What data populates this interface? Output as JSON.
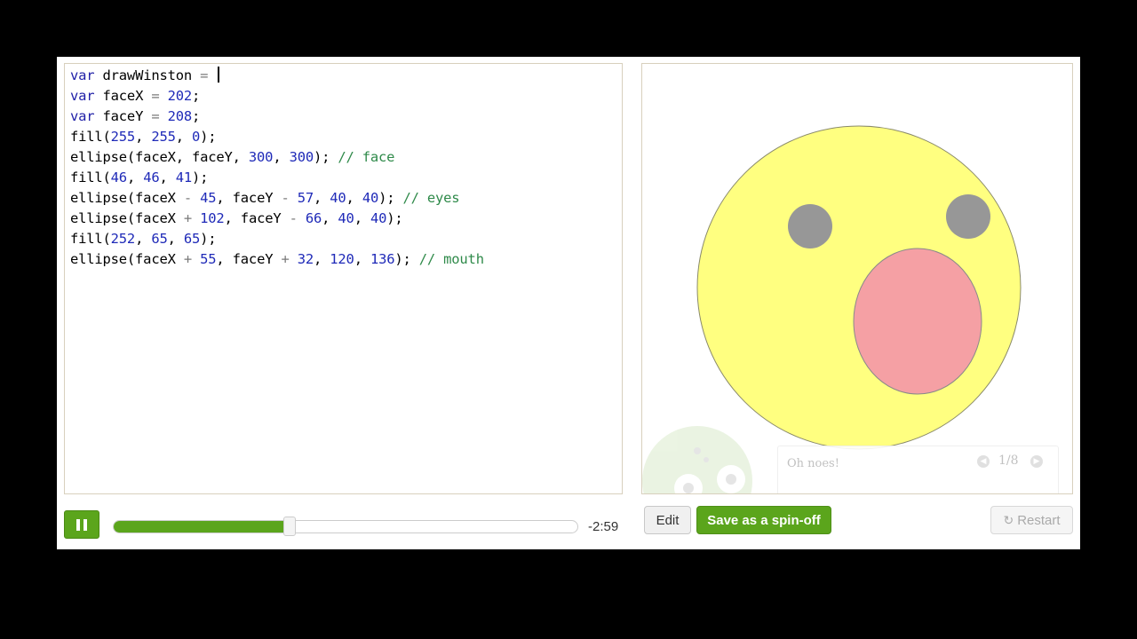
{
  "editor": {
    "lines": [
      [
        {
          "t": "var",
          "c": "kw"
        },
        {
          "t": " drawWinston "
        },
        {
          "t": "=",
          "c": "op"
        },
        {
          "t": " "
        }
      ],
      [
        {
          "t": "var",
          "c": "kw"
        },
        {
          "t": " faceX "
        },
        {
          "t": "=",
          "c": "op"
        },
        {
          "t": " "
        },
        {
          "t": "202",
          "c": "num"
        },
        {
          "t": ";"
        }
      ],
      [
        {
          "t": "var",
          "c": "kw"
        },
        {
          "t": " faceY "
        },
        {
          "t": "=",
          "c": "op"
        },
        {
          "t": " "
        },
        {
          "t": "208",
          "c": "num"
        },
        {
          "t": ";"
        }
      ],
      [
        {
          "t": "fill("
        },
        {
          "t": "255",
          "c": "num"
        },
        {
          "t": ", "
        },
        {
          "t": "255",
          "c": "num"
        },
        {
          "t": ", "
        },
        {
          "t": "0",
          "c": "num"
        },
        {
          "t": ");"
        }
      ],
      [
        {
          "t": "ellipse(faceX, faceY, "
        },
        {
          "t": "300",
          "c": "num"
        },
        {
          "t": ", "
        },
        {
          "t": "300",
          "c": "num"
        },
        {
          "t": "); "
        },
        {
          "t": "// face",
          "c": "cmt"
        }
      ],
      [
        {
          "t": "fill("
        },
        {
          "t": "46",
          "c": "num"
        },
        {
          "t": ", "
        },
        {
          "t": "46",
          "c": "num"
        },
        {
          "t": ", "
        },
        {
          "t": "41",
          "c": "num"
        },
        {
          "t": ");"
        }
      ],
      [
        {
          "t": "ellipse(faceX "
        },
        {
          "t": "-",
          "c": "op"
        },
        {
          "t": " "
        },
        {
          "t": "45",
          "c": "num"
        },
        {
          "t": ", faceY "
        },
        {
          "t": "-",
          "c": "op"
        },
        {
          "t": " "
        },
        {
          "t": "57",
          "c": "num"
        },
        {
          "t": ", "
        },
        {
          "t": "40",
          "c": "num"
        },
        {
          "t": ", "
        },
        {
          "t": "40",
          "c": "num"
        },
        {
          "t": "); "
        },
        {
          "t": "// eyes",
          "c": "cmt"
        }
      ],
      [
        {
          "t": "ellipse(faceX "
        },
        {
          "t": "+",
          "c": "op"
        },
        {
          "t": " "
        },
        {
          "t": "102",
          "c": "num"
        },
        {
          "t": ", faceY "
        },
        {
          "t": "-",
          "c": "op"
        },
        {
          "t": " "
        },
        {
          "t": "66",
          "c": "num"
        },
        {
          "t": ", "
        },
        {
          "t": "40",
          "c": "num"
        },
        {
          "t": ", "
        },
        {
          "t": "40",
          "c": "num"
        },
        {
          "t": ");"
        }
      ],
      [
        {
          "t": "fill("
        },
        {
          "t": "252",
          "c": "num"
        },
        {
          "t": ", "
        },
        {
          "t": "65",
          "c": "num"
        },
        {
          "t": ", "
        },
        {
          "t": "65",
          "c": "num"
        },
        {
          "t": ");"
        }
      ],
      [
        {
          "t": "ellipse(faceX "
        },
        {
          "t": "+",
          "c": "op"
        },
        {
          "t": " "
        },
        {
          "t": "55",
          "c": "num"
        },
        {
          "t": ", faceY "
        },
        {
          "t": "+",
          "c": "op"
        },
        {
          "t": " "
        },
        {
          "t": "32",
          "c": "num"
        },
        {
          "t": ", "
        },
        {
          "t": "120",
          "c": "num"
        },
        {
          "t": ", "
        },
        {
          "t": "136",
          "c": "num"
        },
        {
          "t": "); "
        },
        {
          "t": "// mouth",
          "c": "cmt"
        }
      ]
    ]
  },
  "player": {
    "progress": 0.38,
    "time_remaining": "-2:59"
  },
  "error_tip": {
    "title": "Oh noes!",
    "count": "1/8"
  },
  "buttons": {
    "edit": "Edit",
    "spinoff": "Save as a spin-off",
    "restart": "Restart"
  },
  "colors": {
    "face": "#ffff80",
    "eyes": "#979797",
    "mouth": "#f5a0a4",
    "accent": "#5ba51c"
  }
}
